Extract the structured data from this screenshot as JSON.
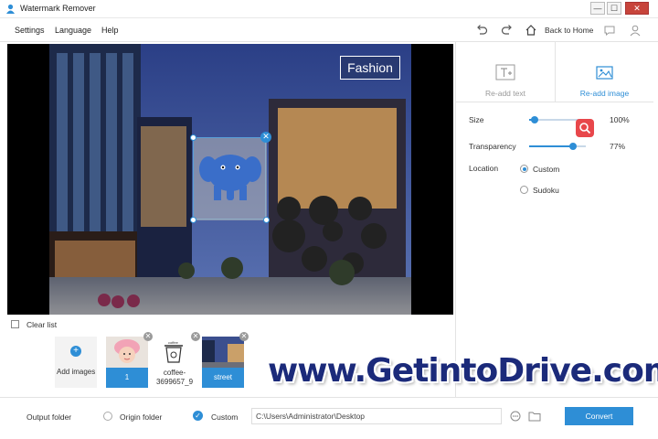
{
  "app": {
    "title": "Watermark Remover"
  },
  "window": {
    "minimize": "—",
    "maximize": "☐",
    "close": "✕"
  },
  "menu": {
    "settings": "Settings",
    "language": "Language",
    "help": "Help"
  },
  "toolbar": {
    "back_home": "Back to Home"
  },
  "canvas": {
    "fashion_text": "Fashion",
    "close_glyph": "✕"
  },
  "panel": {
    "tabs": [
      {
        "label": "Re-add text",
        "active": false
      },
      {
        "label": "Re-add image",
        "active": true
      }
    ],
    "size": {
      "label": "Size",
      "value": "100%",
      "level": 0.1
    },
    "transparency": {
      "label": "Transparency",
      "value": "77%",
      "level": 0.77
    },
    "location": {
      "label": "Location",
      "options": [
        {
          "label": "Custom",
          "selected": true
        },
        {
          "label": "Sudoku",
          "selected": false
        }
      ]
    }
  },
  "filelist": {
    "clear_label": "Clear list",
    "add_label": "Add images",
    "add_glyph": "+",
    "remove_glyph": "✕",
    "items": [
      {
        "caption": "1",
        "active": true
      },
      {
        "caption": "coffee-3699657_9",
        "active": false
      },
      {
        "caption": "street",
        "active": true
      }
    ]
  },
  "watermark_overlay": "www.GetintoDrive.com",
  "bottom": {
    "output_folder_label": "Output folder",
    "origin_folder_label": "Origin folder",
    "custom_label": "Custom",
    "check_glyph": "✓",
    "path": "C:\\Users\\Administrator\\Desktop",
    "convert_label": "Convert"
  },
  "colors": {
    "accent": "#2e8ed6",
    "danger": "#e8474b",
    "watermark": "#1b2a7a"
  }
}
